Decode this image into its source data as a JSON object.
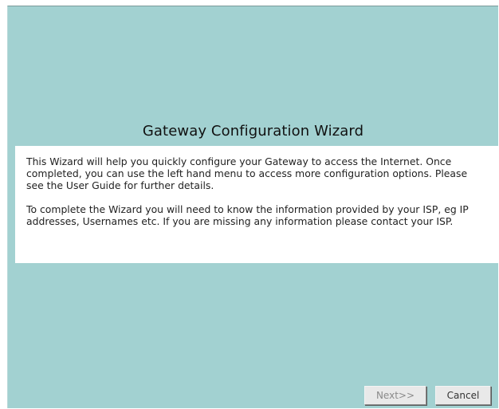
{
  "wizard": {
    "title": "Gateway Configuration Wizard",
    "paragraph_1": "This Wizard will help you quickly configure your Gateway to access the Internet. Once completed, you can use the left hand menu to access more configuration options. Please see the User Guide for further details.",
    "paragraph_2": "To complete the Wizard you will need to know the information provided by your ISP, eg IP addresses, Usernames etc. If you are missing any information please contact your ISP."
  },
  "buttons": {
    "next_label": "Next>>",
    "cancel_label": "Cancel"
  },
  "colors": {
    "background": "#a2d1d1",
    "panel": "#ffffff"
  }
}
